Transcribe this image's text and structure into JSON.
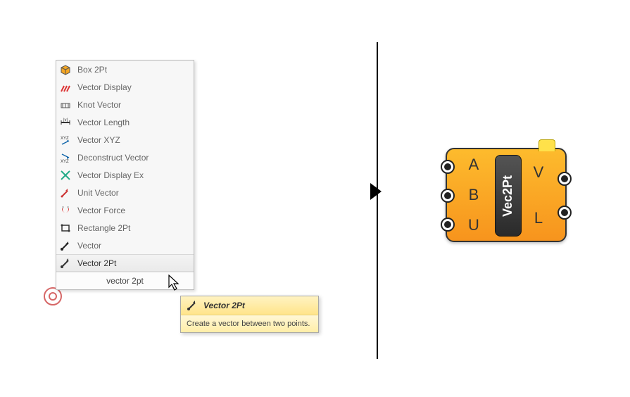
{
  "menu": {
    "items": [
      {
        "label": "Box 2Pt",
        "icon": "box"
      },
      {
        "label": "Vector Display",
        "icon": "vec-display"
      },
      {
        "label": "Knot Vector",
        "icon": "knot"
      },
      {
        "label": "Vector Length",
        "icon": "vec-len"
      },
      {
        "label": "Vector XYZ",
        "icon": "xyz"
      },
      {
        "label": "Deconstruct Vector",
        "icon": "decon"
      },
      {
        "label": "Vector Display Ex",
        "icon": "vec-disp-ex"
      },
      {
        "label": "Unit Vector",
        "icon": "unit-vec"
      },
      {
        "label": "Vector Force",
        "icon": "magnet"
      },
      {
        "label": "Rectangle 2Pt",
        "icon": "rect"
      },
      {
        "label": "Vector",
        "icon": "vector"
      },
      {
        "label": "Vector 2Pt",
        "icon": "vec2pt"
      }
    ],
    "hovered_index": 11,
    "search_value": "vector 2pt"
  },
  "tooltip": {
    "title": "Vector 2Pt",
    "body": "Create a vector between two points."
  },
  "component": {
    "name": "Vec2Pt",
    "inputs": [
      "A",
      "B",
      "U"
    ],
    "outputs": [
      "V",
      "L"
    ]
  }
}
